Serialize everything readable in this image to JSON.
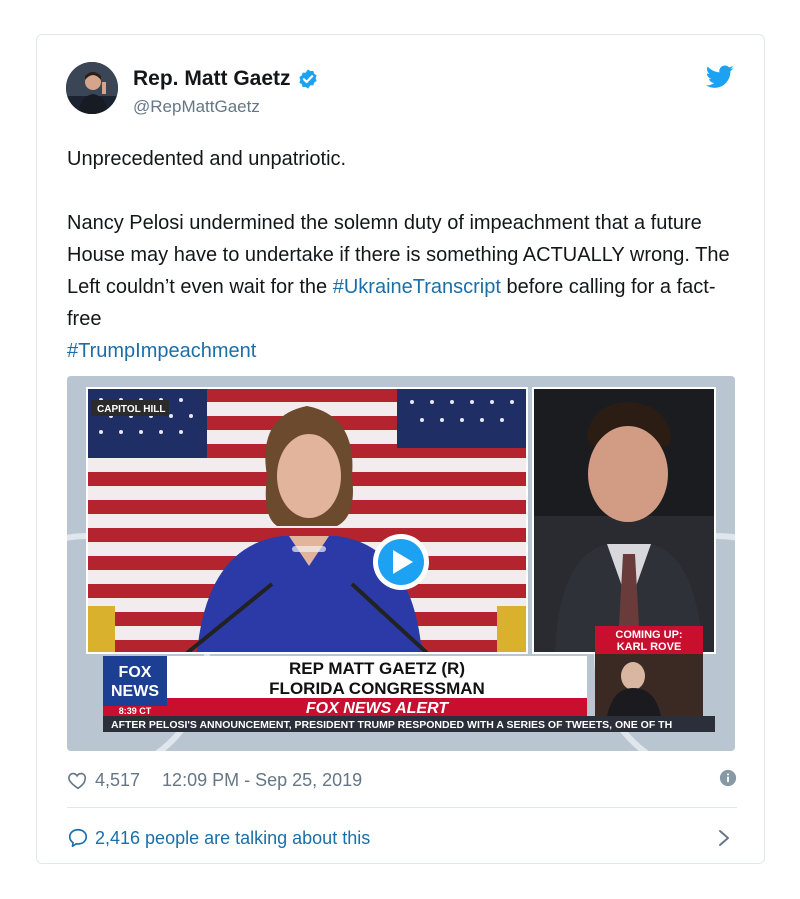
{
  "author": {
    "display_name": "Rep. Matt Gaetz",
    "handle": "@RepMattGaetz",
    "verified": true,
    "avatar_icon": "avatar-photo"
  },
  "tweet": {
    "line1": "Unprecedented and unpatriotic.",
    "para_text1": "Nancy Pelosi undermined the solemn duty of impeachment that a future House may have to undertake if there is something ACTUALLY wrong. The Left couldn’t even wait for the ",
    "hashtag1": "#UkraineTranscript",
    "para_text2": " before calling for a fact-free ",
    "hashtag2": "#TrumpImpeachment"
  },
  "media": {
    "location_tag": "CAPITOL HILL",
    "coming_up_line1": "COMING UP:",
    "coming_up_line2": "KARL ROVE",
    "chyron_line1": "REP MATT GAETZ (R)",
    "chyron_line2": "FLORIDA CONGRESSMAN",
    "alert": "FOX NEWS ALERT",
    "network_line1": "FOX",
    "network_line2": "NEWS",
    "clock": "8:39 CT",
    "ticker": "AFTER PELOSI'S ANNOUNCEMENT, PRESIDENT TRUMP RESPONDED WITH A SERIES OF TWEETS, ONE OF TH"
  },
  "meta": {
    "likes": "4,517",
    "timestamp": "12:09 PM - Sep 25, 2019"
  },
  "footer": {
    "talking": "2,416 people are talking about this"
  },
  "colors": {
    "link": "#1b6fa8",
    "twitter_blue": "#1da1f2",
    "muted": "#657786",
    "fox_red": "#c8102e",
    "fox_blue": "#1c3f94"
  }
}
